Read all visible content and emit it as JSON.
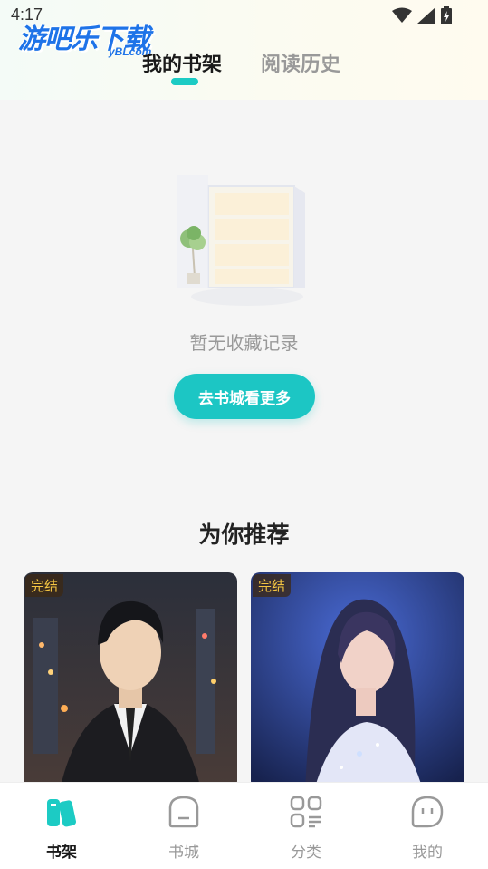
{
  "status": {
    "time": "4:17"
  },
  "watermark": {
    "main": "游吧乐下载",
    "sub": "yBLcom"
  },
  "tabs": [
    {
      "label": "我的书架",
      "active": true
    },
    {
      "label": "阅读历史",
      "active": false
    }
  ],
  "empty": {
    "text": "暂无收藏记录",
    "button": "去书城看更多"
  },
  "recommend": {
    "title": "为你推荐",
    "books": [
      {
        "badge": "完结",
        "cover": "man-in-suit-city-night"
      },
      {
        "badge": "完结",
        "cover": "woman-blue-glow"
      }
    ]
  },
  "nav": [
    {
      "label": "书架",
      "icon": "bookshelf-icon",
      "active": true
    },
    {
      "label": "书城",
      "icon": "store-icon",
      "active": false
    },
    {
      "label": "分类",
      "icon": "category-icon",
      "active": false
    },
    {
      "label": "我的",
      "icon": "profile-icon",
      "active": false
    }
  ],
  "colors": {
    "accent": "#1cc6c4",
    "badge_text": "#f4c542"
  }
}
